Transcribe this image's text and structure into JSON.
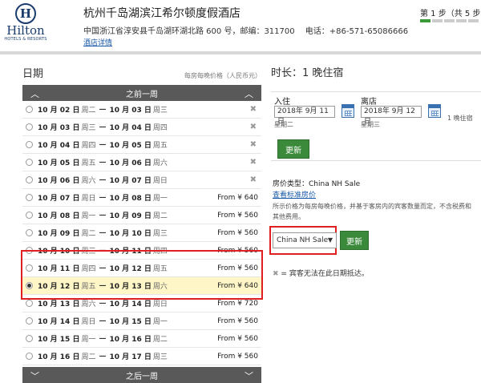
{
  "header": {
    "logo_word": "Hilton",
    "logo_sub": "HOTELS & RESORTS",
    "hotel_name": "杭州千岛湖滨江希尔顿度假酒店",
    "address": "中国浙江省淳安县千岛湖环湖北路 600 号，邮编：311700　 电话：+86-571-65086666",
    "hotel_link": "酒店详情",
    "step": "第 1 步（共 5 步）",
    "step_total": 5,
    "step_current": 1
  },
  "dates": {
    "title": "日期",
    "note": "每房每晚价格（人民币元）",
    "prev_week": "之前一周",
    "next_week": "之后一周",
    "rows": [
      {
        "from_date": "10 月 02 日",
        "from_wd": "周二",
        "to_date": "10 月 03 日",
        "to_wd": "周三",
        "price": "",
        "unavailable": true
      },
      {
        "from_date": "10 月 03 日",
        "from_wd": "周三",
        "to_date": "10 月 04 日",
        "to_wd": "周四",
        "price": "",
        "unavailable": true
      },
      {
        "from_date": "10 月 04 日",
        "from_wd": "周四",
        "to_date": "10 月 05 日",
        "to_wd": "周五",
        "price": "",
        "unavailable": true
      },
      {
        "from_date": "10 月 05 日",
        "from_wd": "周五",
        "to_date": "10 月 06 日",
        "to_wd": "周六",
        "price": "",
        "unavailable": true
      },
      {
        "from_date": "10 月 06 日",
        "from_wd": "周六",
        "to_date": "10 月 07 日",
        "to_wd": "周日",
        "price": "",
        "unavailable": true
      },
      {
        "from_date": "10 月 07 日",
        "from_wd": "周日",
        "to_date": "10 月 08 日",
        "to_wd": "周一",
        "price": "From ¥ 640",
        "unavailable": false
      },
      {
        "from_date": "10 月 08 日",
        "from_wd": "周一",
        "to_date": "10 月 09 日",
        "to_wd": "周二",
        "price": "From ¥ 560",
        "unavailable": false
      },
      {
        "from_date": "10 月 09 日",
        "from_wd": "周二",
        "to_date": "10 月 10 日",
        "to_wd": "周三",
        "price": "From ¥ 560",
        "unavailable": false
      },
      {
        "from_date": "10 月 10 日",
        "from_wd": "周三",
        "to_date": "10 月 11 日",
        "to_wd": "周四",
        "price": "From ¥ 560",
        "unavailable": false
      },
      {
        "from_date": "10 月 11 日",
        "from_wd": "周四",
        "to_date": "10 月 12 日",
        "to_wd": "周五",
        "price": "From ¥ 560",
        "unavailable": false
      },
      {
        "from_date": "10 月 12 日",
        "from_wd": "周五",
        "to_date": "10 月 13 日",
        "to_wd": "周六",
        "price": "From ¥ 640",
        "unavailable": false,
        "selected": true
      },
      {
        "from_date": "10 月 13 日",
        "from_wd": "周六",
        "to_date": "10 月 14 日",
        "to_wd": "周日",
        "price": "From ¥ 720",
        "unavailable": false
      },
      {
        "from_date": "10 月 14 日",
        "from_wd": "周日",
        "to_date": "10 月 15 日",
        "to_wd": "周一",
        "price": "From ¥ 560",
        "unavailable": false
      },
      {
        "from_date": "10 月 15 日",
        "from_wd": "周一",
        "to_date": "10 月 16 日",
        "to_wd": "周二",
        "price": "From ¥ 560",
        "unavailable": false
      },
      {
        "from_date": "10 月 16 日",
        "from_wd": "周二",
        "to_date": "10 月 17 日",
        "to_wd": "周三",
        "price": "From ¥ 560",
        "unavailable": false
      }
    ]
  },
  "stay": {
    "title": "时长：1 晚住宿",
    "checkin_label": "入住",
    "checkin_value": "2018年 9月 11日",
    "checkin_wd": "星期二",
    "checkout_label": "离店",
    "checkout_value": "2018年 9月 12日",
    "checkout_wd": "星期三",
    "nights": "1 晚住宿",
    "update_label": "更新"
  },
  "rate": {
    "type_label": "房价类型：China NH Sale",
    "standard_link": "查看标准房价",
    "note": "所示价格为每房每晚价格，并基于客房内的宾客数量而定，不含税费和其他费用。",
    "select_value": "China NH Sale",
    "update_label": "更新",
    "legend": "= 宾客无法在此日期抵达。"
  },
  "colors": {
    "accent_green": "#3b8a3b",
    "highlight_red": "#e02020",
    "selected_row": "#fff6c8",
    "bar_gray": "#595959"
  }
}
